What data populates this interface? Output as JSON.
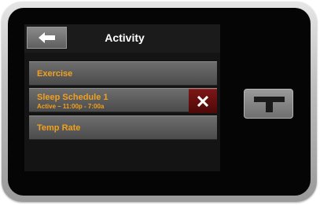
{
  "header": {
    "title": "Activity",
    "back_icon": "arrow-left-icon"
  },
  "menu": {
    "items": [
      {
        "label": "Exercise"
      },
      {
        "label": "Sleep Schedule 1",
        "sublabel": "Active – 11:00p - 7:00a",
        "delete_icon": "close-icon"
      },
      {
        "label": "Temp Rate"
      }
    ]
  },
  "device": {
    "hardware_button_icon": "t-logo-icon"
  },
  "colors": {
    "accent_text": "#f2a11e",
    "row_background": "#5c5c5c",
    "delete_background": "#6a1010",
    "screen_background": "#141414"
  }
}
